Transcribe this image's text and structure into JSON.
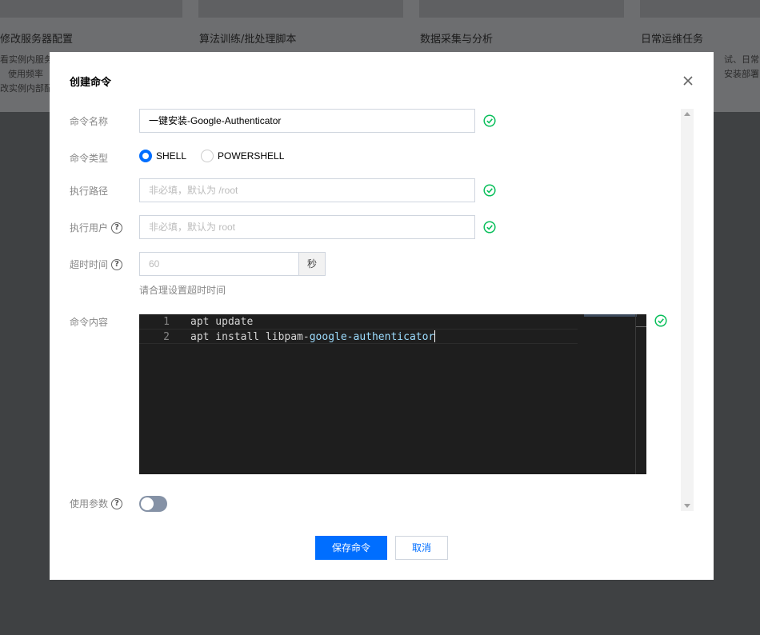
{
  "background": {
    "cards": [
      {
        "title": "修改服务器配置",
        "desc": [
          "看实例内服务",
          "使用频率",
          "改实例内部配"
        ]
      },
      {
        "title": "算法训练/批处理脚本",
        "desc": []
      },
      {
        "title": "数据采集与分析",
        "desc": []
      },
      {
        "title": "日常运维任务",
        "desc": [
          "试、日常",
          "安装部署"
        ]
      }
    ]
  },
  "modal": {
    "title": "创建命令",
    "close_icon": "close-icon",
    "fields": {
      "name": {
        "label": "命令名称",
        "value": "一键安装-Google-Authenticator"
      },
      "type": {
        "label": "命令类型",
        "options": [
          "SHELL",
          "POWERSHELL"
        ],
        "selected": "SHELL"
      },
      "path": {
        "label": "执行路径",
        "placeholder": "非必填，默认为 /root"
      },
      "user": {
        "label": "执行用户",
        "placeholder": "非必填，默认为 root"
      },
      "timeout": {
        "label": "超时时间",
        "placeholder": "60",
        "unit": "秒",
        "hint": "请合理设置超时时间"
      },
      "content": {
        "label": "命令内容",
        "lines": [
          {
            "no": "1",
            "text": "apt update",
            "plain": "",
            "highlight": ""
          },
          {
            "no": "2",
            "text": "",
            "plain": "apt install libpam-",
            "highlight": "google-authenticator"
          }
        ]
      },
      "params": {
        "label": "使用参数",
        "enabled": false
      }
    },
    "buttons": {
      "save": "保存命令",
      "cancel": "取消"
    },
    "colors": {
      "primary": "#006eff",
      "success": "#0abf5b",
      "toggle_off": "#8592a6",
      "editor_bg": "#1e1e1e"
    }
  }
}
